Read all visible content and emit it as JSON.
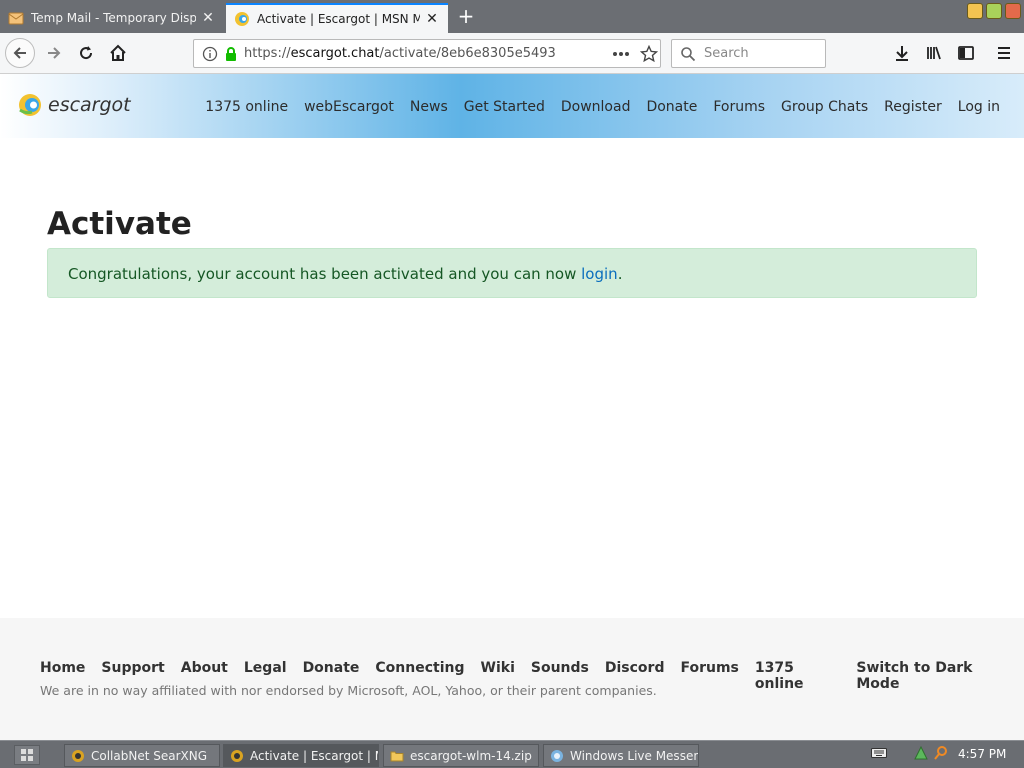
{
  "browser": {
    "tabs": [
      {
        "label": "Temp Mail - Temporary Disposable Email",
        "state": "inactive"
      },
      {
        "label": "Activate | Escargot | MSN Messenger",
        "state": "active"
      }
    ],
    "url_prefix": "https://",
    "url_host": "escargot.chat",
    "url_path": "/activate/8eb6e8305e5493",
    "search_placeholder": "Search",
    "new_tab_symbol": "+"
  },
  "site": {
    "logo_text": "escargot",
    "nav": [
      "1375 online",
      "webEscargot",
      "News",
      "Get Started",
      "Download",
      "Donate",
      "Forums",
      "Group Chats",
      "Register",
      "Log in"
    ]
  },
  "main": {
    "title": "Activate",
    "alert_text": "Congratulations, your account has been activated and you can now ",
    "alert_link": "login",
    "alert_end": "."
  },
  "footer": {
    "links": [
      "Home",
      "Support",
      "About",
      "Legal",
      "Donate",
      "Connecting",
      "Wiki",
      "Sounds",
      "Discord",
      "Forums",
      "1375 online",
      "Switch to Dark Mode"
    ],
    "disclaimer": "We are in no way affiliated with nor endorsed by Microsoft, AOL, Yahoo, or their parent companies."
  },
  "taskbar": {
    "tasks": [
      "CollabNet SearXNG",
      "Activate | Escargot | MSN Messenger",
      "escargot-wlm-14.zip",
      "Windows Live Messenger"
    ],
    "clock": "4:57 PM"
  },
  "colors": {
    "accent_blue": "#0a84ff",
    "alert_bg": "#d4edda",
    "alert_text": "#155724",
    "link": "#0a6ebd",
    "lock_green": "#12bc00"
  }
}
